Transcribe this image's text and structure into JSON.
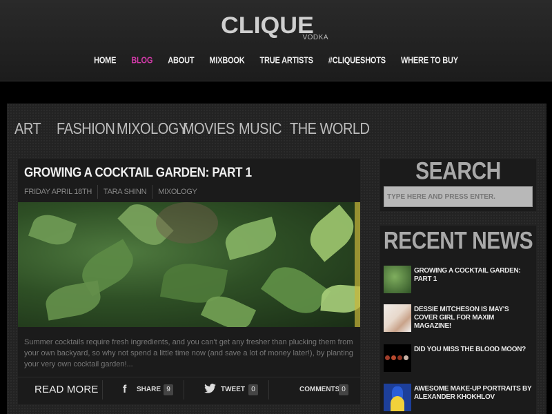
{
  "brand": {
    "name": "CLIQUE",
    "sub": "VODKA"
  },
  "top_nav": [
    {
      "label": "HOME",
      "active": false
    },
    {
      "label": "BLOG",
      "active": true
    },
    {
      "label": "ABOUT",
      "active": false
    },
    {
      "label": "MIXBOOK",
      "active": false
    },
    {
      "label": "TRUE ARTISTS",
      "active": false
    },
    {
      "label": "#CLIQUESHOTS",
      "active": false
    },
    {
      "label": "WHERE TO BUY",
      "active": false
    }
  ],
  "categories": [
    "ART",
    "FASHION",
    "MIXOLOGY",
    "MOVIES",
    "MUSIC",
    "THE WORLD"
  ],
  "post": {
    "title": "GROWING A COCKTAIL GARDEN: PART 1",
    "date": "FRIDAY APRIL 18TH",
    "author": "TARA SHINN",
    "category": "MIXOLOGY",
    "excerpt": "Summer cocktails require fresh ingredients, and you can't get any fresher than plucking them from your own backyard, so why not spend a little time now (and save a lot of money later!), by planting your very own cocktail garden!...",
    "read_more": "READ MORE",
    "share_label": "SHARE",
    "share_count": "9",
    "tweet_label": "TWEET",
    "tweet_count": "0",
    "comments_label": "COMMENTS",
    "comments_count": "0"
  },
  "sidebar": {
    "search_heading": "SEARCH",
    "search_placeholder": "TYPE HERE AND PRESS ENTER.",
    "recent_heading": "RECENT NEWS",
    "recent": [
      {
        "title": "GROWING A COCKTAIL GARDEN: PART 1"
      },
      {
        "title": "DESSIE MITCHESON IS MAY'S COVER GIRL FOR MAXIM MAGAZINE!"
      },
      {
        "title": "DID YOU MISS THE BLOOD MOON?"
      },
      {
        "title": "AWESOME MAKE-UP PORTRAITS BY ALEXANDER KHOKHLOV"
      }
    ]
  },
  "colors": {
    "accent": "#d23aa8",
    "panel": "#1b1b1b",
    "background": "#232323"
  }
}
